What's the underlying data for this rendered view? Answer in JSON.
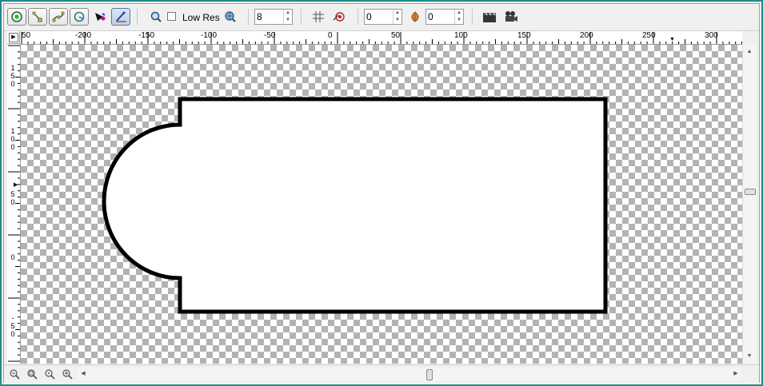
{
  "toolbar": {
    "tools": [
      {
        "name": "pick-tool",
        "icon": "target-icon"
      },
      {
        "name": "node-tool",
        "icon": "node-edit-icon"
      },
      {
        "name": "bezier-tool",
        "icon": "bezier-icon"
      },
      {
        "name": "ellipse-tool",
        "icon": "ellipse-icon"
      },
      {
        "name": "brush-tool",
        "icon": "brush-icon"
      },
      {
        "name": "pen-tool",
        "icon": "pen-icon"
      }
    ],
    "low_res_label": "Low Res",
    "low_res_checked": false,
    "value_1": "8",
    "value_2": "0",
    "value_3": "0"
  },
  "ruler": {
    "horizontal": [
      "50",
      "-200",
      "-150",
      "-100",
      "-50",
      "0",
      "50",
      "100",
      "150",
      "200",
      "250",
      "300"
    ],
    "vertical": [
      [
        "1",
        "5",
        "0"
      ],
      [
        "1",
        "0",
        "0"
      ],
      [
        "5",
        "0"
      ],
      [
        "0"
      ],
      [
        "-",
        "5",
        "0"
      ]
    ]
  },
  "colors": {
    "frame": "#1f8a8a",
    "shape_stroke": "#000000",
    "shape_fill": "#ffffff",
    "checker_dark": "#b3b3b3"
  }
}
